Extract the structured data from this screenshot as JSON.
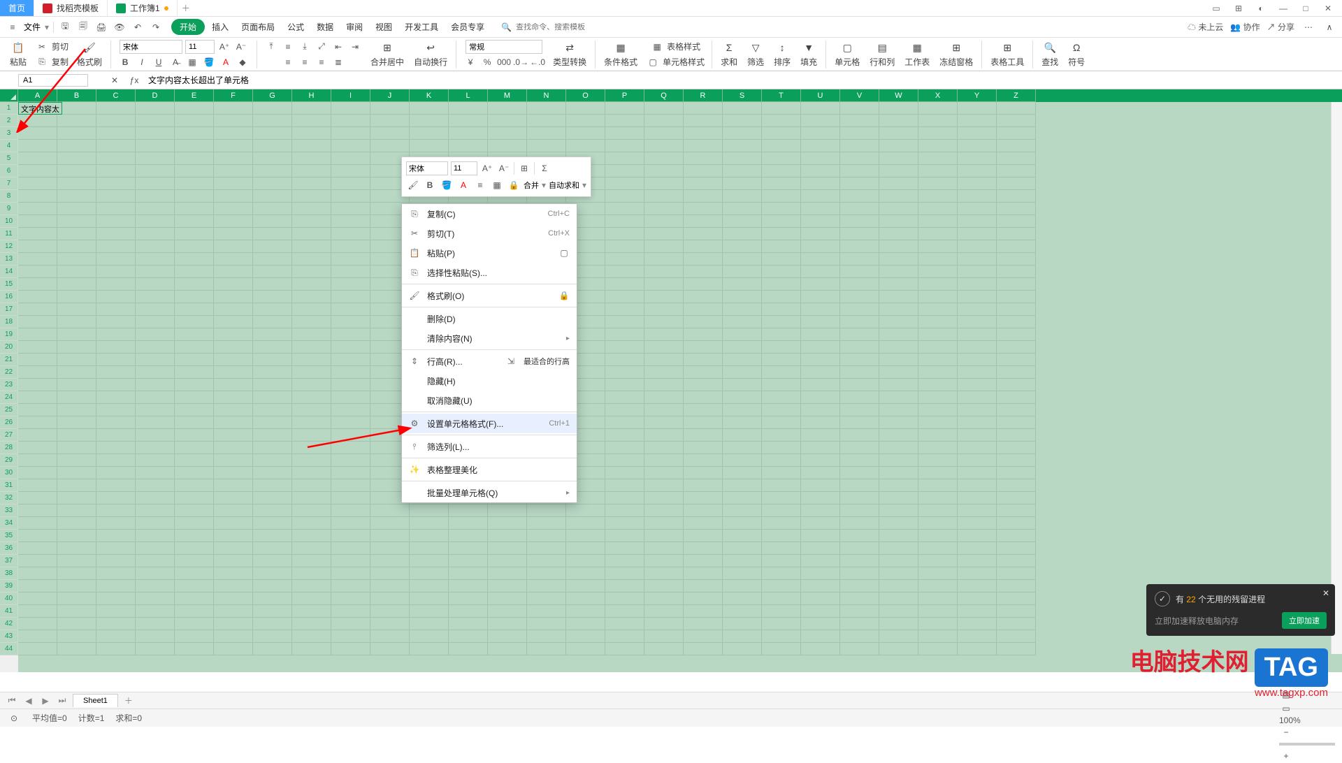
{
  "tabs": {
    "home": "首页",
    "template": "找稻壳模板",
    "workbook": "工作簿1"
  },
  "menu": {
    "file": "文件",
    "start": "开始",
    "insert": "插入",
    "layout": "页面布局",
    "formula": "公式",
    "data": "数据",
    "review": "审阅",
    "view": "视图",
    "dev": "开发工具",
    "member": "会员专享",
    "search_ph": "查找命令、搜索模板"
  },
  "topright": {
    "cloud": "未上云",
    "coop": "协作",
    "share": "分享"
  },
  "ribbon": {
    "paste": "粘贴",
    "cut": "剪切",
    "copy": "复制",
    "format_painter": "格式刷",
    "font": "宋体",
    "size": "11",
    "merge": "合并居中",
    "wrap": "自动换行",
    "general": "常规",
    "type_convert": "类型转换",
    "cond_format": "条件格式",
    "table_style": "表格样式",
    "cell_style": "单元格样式",
    "sum": "求和",
    "filter": "筛选",
    "sort": "排序",
    "fill": "填充",
    "cell": "单元格",
    "rowcol": "行和列",
    "worksheet": "工作表",
    "freeze": "冻结窗格",
    "table_tool": "表格工具",
    "find": "查找",
    "symbol": "符号"
  },
  "namebox": "A1",
  "formula": "文字内容太长超出了单元格",
  "cell_a1": "文字内容太",
  "cols": [
    "A",
    "B",
    "C",
    "D",
    "E",
    "F",
    "G",
    "H",
    "I",
    "J",
    "K",
    "L",
    "M",
    "N",
    "O",
    "P",
    "Q",
    "R",
    "S",
    "T",
    "U",
    "V",
    "W",
    "X",
    "Y",
    "Z"
  ],
  "mini": {
    "font": "宋体",
    "size": "11",
    "merge": "合并",
    "autosum": "自动求和"
  },
  "cm": {
    "copy": "复制(C)",
    "copy_sc": "Ctrl+C",
    "cut": "剪切(T)",
    "cut_sc": "Ctrl+X",
    "paste": "粘贴(P)",
    "paste_special": "选择性粘贴(S)...",
    "format_painter": "格式刷(O)",
    "delete": "删除(D)",
    "clear": "清除内容(N)",
    "row_height": "行高(R)...",
    "best_height": "最适合的行高",
    "hide": "隐藏(H)",
    "unhide": "取消隐藏(U)",
    "format_cells": "设置单元格格式(F)...",
    "format_cells_sc": "Ctrl+1",
    "filter": "筛选列(L)...",
    "beautify": "表格整理美化",
    "batch": "批量处理单元格(Q)"
  },
  "sheet": "Sheet1",
  "status": {
    "avg": "平均值=0",
    "count": "计数=1",
    "sum": "求和=0",
    "zoom": "100%"
  },
  "notif": {
    "title_a": "有",
    "title_b": "22",
    "title_c": "个无用的残留进程",
    "sub": "立即加速释放电脑内存",
    "btn": "立即加速"
  },
  "watermark": {
    "line1": "电脑技术网",
    "line2": "www.tagxp.com",
    "tag": "TAG"
  }
}
